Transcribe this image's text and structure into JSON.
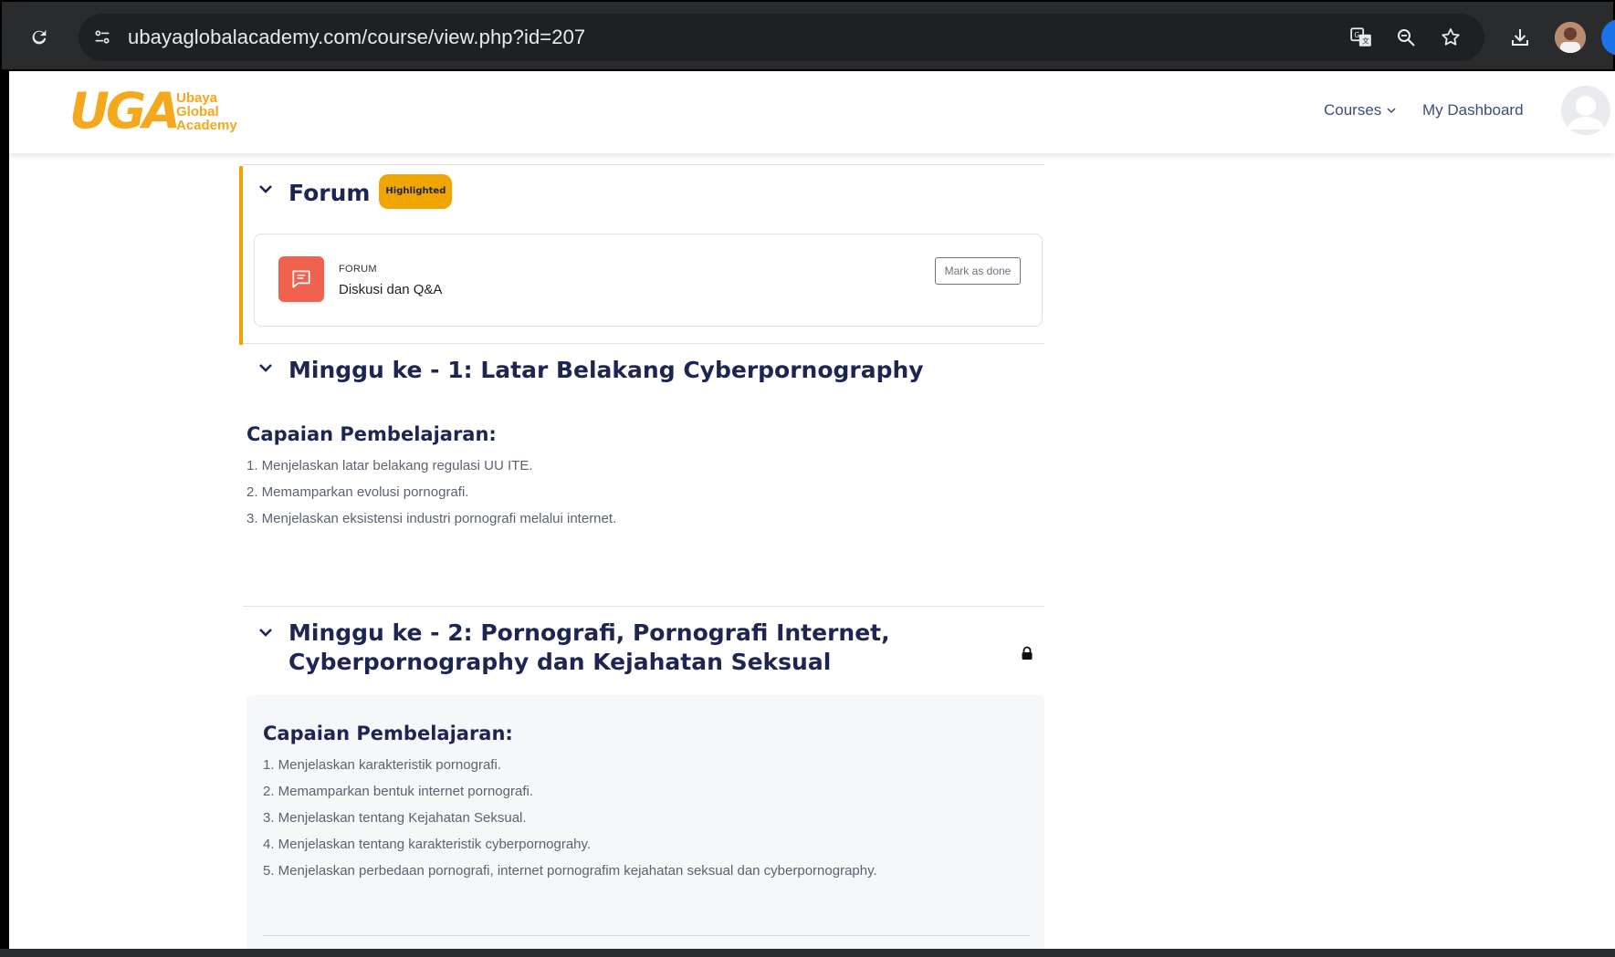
{
  "browser": {
    "url": "ubayaglobalacademy.com/course/view.php?id=207"
  },
  "logo": {
    "mark": "UGA",
    "line1": "Ubaya",
    "line2": "Global",
    "line3": "Academy"
  },
  "nav": {
    "courses": "Courses",
    "dashboard": "My Dashboard"
  },
  "forum_section": {
    "title": "Forum",
    "badge": "Highlighted",
    "activity": {
      "type": "FORUM",
      "name": "Diskusi dan Q&A",
      "mark_done": "Mark as done"
    }
  },
  "week1": {
    "title": "Minggu ke - 1: Latar Belakang Cyberpornography",
    "heading": "Capaian Pembelajaran:",
    "items": [
      "1. Menjelaskan latar belakang regulasi UU ITE.",
      "2. Memamparkan evolusi pornografi.",
      "3. Menjelaskan eksistensi industri pornografi melalui internet."
    ]
  },
  "week2": {
    "title_line1": "Minggu ke - 2: Pornografi, Pornografi Internet,",
    "title_line2": "Cyberpornography dan Kejahatan Seksual",
    "heading": "Capaian Pembelajaran:",
    "items": [
      "1. Menjelaskan karakteristik pornografi.",
      "2. Memamparkan bentuk internet pornografi.",
      "3. Menjelaskan tentang Kejahatan Seksual.",
      "4. Menjelaskan tentang karakteristik cyberpornograhy.",
      "5. Menjelaskan perbedaan pornografi, internet pornografim kejahatan seksual dan cyberpornography."
    ]
  },
  "colors": {
    "accent": "#f0a500",
    "heading": "#1d2652",
    "forum_icon": "#f0624d"
  }
}
